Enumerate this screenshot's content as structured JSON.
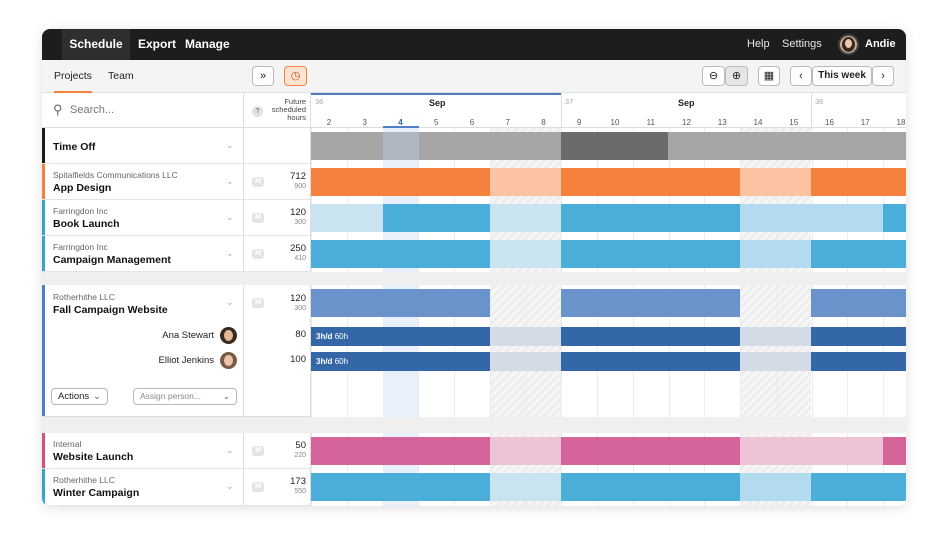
{
  "nav": {
    "items": [
      "Schedule",
      "Export",
      "Manage"
    ],
    "help": "Help",
    "settings": "Settings",
    "user": "Andie"
  },
  "subnav": {
    "tabs": [
      "Projects",
      "Team"
    ],
    "this_week": "This week"
  },
  "search": {
    "placeholder": "Search..."
  },
  "hours_header": {
    "line1": "Future",
    "line2": "scheduled",
    "line3": "hours",
    "help": "?"
  },
  "timeline": {
    "weeks": [
      {
        "num": "36",
        "month": "Sep"
      },
      {
        "num": "37",
        "month": "Sep"
      },
      {
        "num": "38",
        "month": ""
      }
    ],
    "days": [
      "2",
      "3",
      "4",
      "5",
      "6",
      "7",
      "8",
      "9",
      "10",
      "11",
      "12",
      "13",
      "14",
      "15",
      "16",
      "17",
      "18"
    ],
    "today": "4"
  },
  "projects": [
    {
      "client": "",
      "name": "Time Off",
      "hours": "",
      "sub": "",
      "color": "#1a1a1a"
    },
    {
      "client": "Spitalfields Communications LLC",
      "name": "App Design",
      "hours": "712",
      "sub": "900",
      "color": "#f5813f"
    },
    {
      "client": "Farringdon Inc",
      "name": "Book Launch",
      "hours": "120",
      "sub": "300",
      "color": "#3aa0d0"
    },
    {
      "client": "Farringdon Inc",
      "name": "Campaign Management",
      "hours": "250",
      "sub": "410",
      "color": "#3aa0d0"
    },
    {
      "client": "Rotherhithe LLC",
      "name": "Fall Campaign Website",
      "hours": "120",
      "sub": "300",
      "color": "#4f7fc2"
    },
    {
      "client": "Internal",
      "name": "Website Launch",
      "hours": "50",
      "sub": "220",
      "color": "#d4507f"
    },
    {
      "client": "Rotherhithe LLC",
      "name": "Winter Campaign",
      "hours": "173",
      "sub": "550",
      "color": "#3aa0d0"
    }
  ],
  "people": [
    {
      "name": "Ana Stewart",
      "hours": "80",
      "label": "3h/d",
      "total": "60h"
    },
    {
      "name": "Elliot Jenkins",
      "hours": "100",
      "label": "3h/d",
      "total": "60h"
    }
  ],
  "actions": {
    "actions_label": "Actions",
    "assign_placeholder": "Assign person..."
  },
  "badge": "M",
  "colors": {
    "orange": "#f5813f",
    "blue": "#4aaed8",
    "navy": "#3467a8",
    "pink": "#d4649a",
    "gray": "#a6a6a6"
  }
}
